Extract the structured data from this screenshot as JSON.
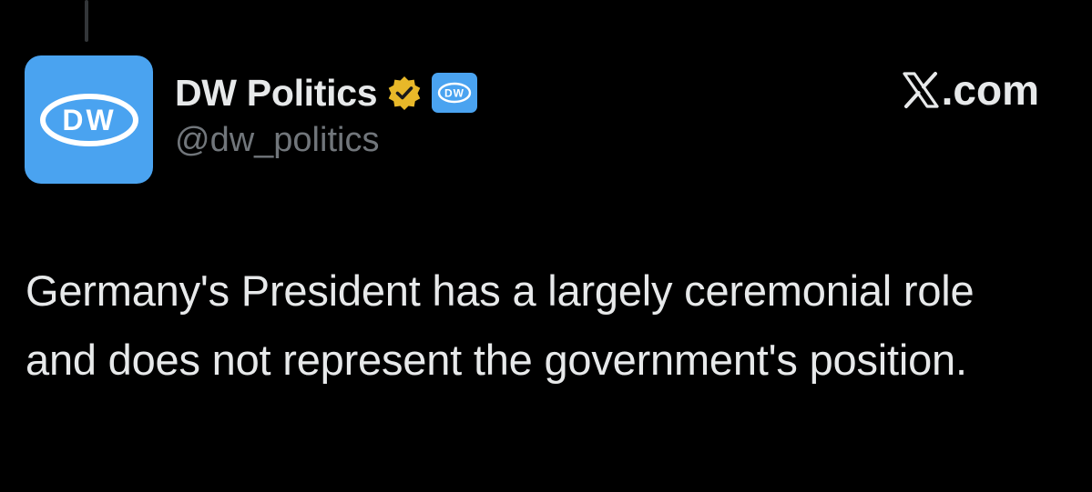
{
  "account": {
    "display_name": "DW Politics",
    "handle": "@dw_politics",
    "avatar_text": "DW",
    "badge_text": "DW",
    "avatar_color": "#4aa3f0",
    "verified_color": "#e8b829"
  },
  "brand": {
    "domain_text": ".com",
    "logo_icon": "x-logo-icon"
  },
  "tweet": {
    "text": "Germany's President has a largely ceremonial role and does not represent the government's position."
  }
}
